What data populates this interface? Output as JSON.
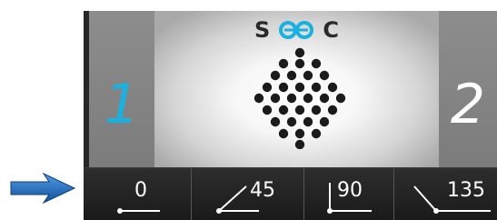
{
  "title": {
    "left_letter": "S",
    "right_letter": "C"
  },
  "panels": {
    "left_number": "1",
    "right_number": "2"
  },
  "angle_options": [
    {
      "label": "0",
      "icon": "angle-0-icon"
    },
    {
      "label": "45",
      "icon": "angle-45-icon"
    },
    {
      "label": "90",
      "icon": "angle-90-icon"
    },
    {
      "label": "135",
      "icon": "angle-135-icon"
    }
  ],
  "colors": {
    "accent_blue": "#19b1e0",
    "arrow_blue": "#1b6fc4",
    "frame_dark": "#262626",
    "side_panel_gray": "#8d8d8d",
    "dot_color": "#1b1b1b"
  }
}
